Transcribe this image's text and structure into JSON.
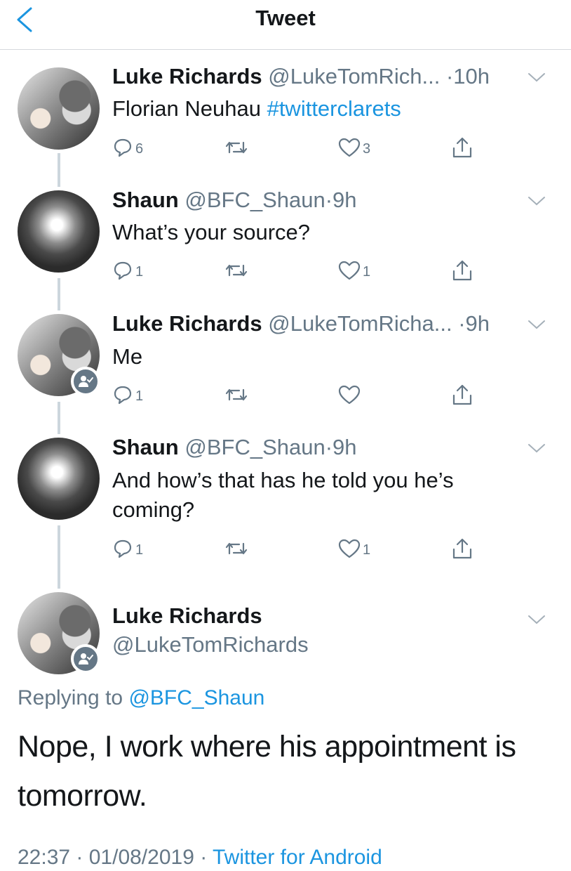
{
  "header": {
    "title": "Tweet"
  },
  "thread": [
    {
      "name": "Luke Richards",
      "handle": "@LukeTomRich...",
      "time": "·10h",
      "text_plain": "Florian Neuhau ",
      "hashtag": "#twittercla­rets",
      "replies": "6",
      "likes": "3"
    },
    {
      "name": "Shaun",
      "handle": "@BFC_Shaun",
      "time": "·9h",
      "text": "What’s your source?",
      "replies": "1",
      "likes": "1"
    },
    {
      "name": "Luke Richards",
      "handle": "@LukeTomRicha...",
      "time": "·9h",
      "text": "Me",
      "replies": "1",
      "likes": ""
    },
    {
      "name": "Shaun",
      "handle": "@BFC_Shaun",
      "time": "·9h",
      "text_line1": "And how’s that has he told you he’s",
      "text_line2": "coming?",
      "replies": "1",
      "likes": "1"
    }
  ],
  "focus": {
    "name": "Luke Richards",
    "handle": "@LukeTomRichards",
    "replying_prefix": "Replying to ",
    "replying_to": "@BFC_Shaun",
    "text": "Nope, I work where his appointment is tomorrow.",
    "time": "22:37 · 01/08/2019 · ",
    "source": "Twitter for Android"
  },
  "colors": {
    "accent": "#1b95e0",
    "secondary": "#657786",
    "line": "#ccd6dd"
  },
  "icons": [
    "back-chevron-icon",
    "reply-icon",
    "retweet-icon",
    "like-icon",
    "share-icon",
    "chevron-down-icon",
    "follows-you-badge-icon"
  ]
}
